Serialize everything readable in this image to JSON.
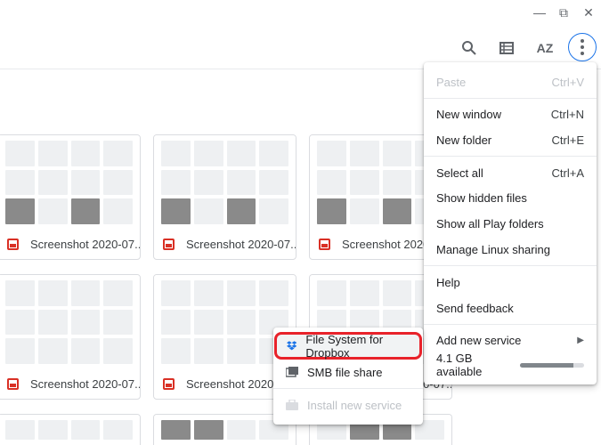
{
  "window": {
    "minimize_icon": "minimize-icon",
    "restore_icon": "restore-icon",
    "close_icon": "close-icon"
  },
  "toolbar": {
    "search": "search-icon",
    "view": "grid-view-icon",
    "sort_label": "AZ",
    "more": "more-vert-icon"
  },
  "files": [
    {
      "name": "Screenshot 2020-07..."
    },
    {
      "name": "Screenshot 2020-07..."
    },
    {
      "name": "Screenshot 2020-..."
    },
    {
      "name": "Screenshot 2020-07..."
    },
    {
      "name": "Screenshot 2020-0"
    },
    {
      "name": "Screenshot 2020-07..."
    }
  ],
  "menu": {
    "paste": {
      "label": "Paste",
      "shortcut": "Ctrl+V"
    },
    "new_window": {
      "label": "New window",
      "shortcut": "Ctrl+N"
    },
    "new_folder": {
      "label": "New folder",
      "shortcut": "Ctrl+E"
    },
    "select_all": {
      "label": "Select all",
      "shortcut": "Ctrl+A"
    },
    "show_hidden": {
      "label": "Show hidden files"
    },
    "show_play": {
      "label": "Show all Play folders"
    },
    "linux_sharing": {
      "label": "Manage Linux sharing"
    },
    "help": {
      "label": "Help"
    },
    "feedback": {
      "label": "Send feedback"
    },
    "add_service": {
      "label": "Add new service"
    },
    "storage": {
      "label": "4.1 GB available",
      "used_fraction": 0.84
    }
  },
  "submenu": {
    "dropbox": {
      "label": "File System for Dropbox"
    },
    "smb": {
      "label": "SMB file share"
    },
    "install": {
      "label": "Install new service"
    }
  },
  "colors": {
    "accent": "#1a73e8",
    "highlight": "#e8222a",
    "file_icon": "#d93025"
  }
}
